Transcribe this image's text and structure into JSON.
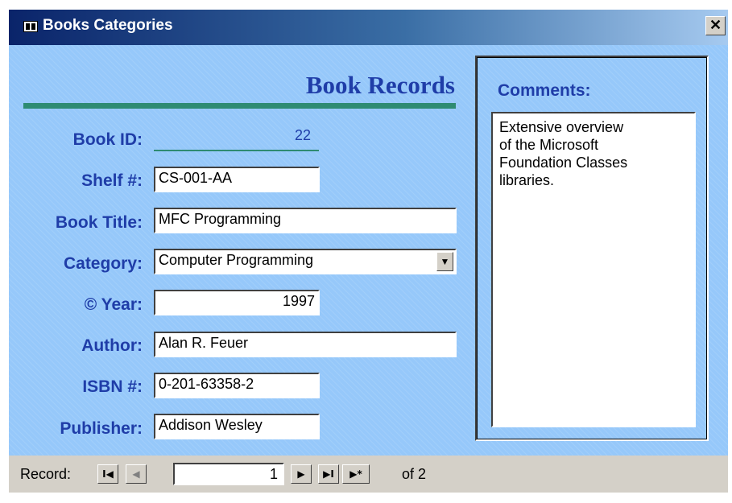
{
  "window": {
    "title": "Books Categories",
    "close_glyph": "✕"
  },
  "form": {
    "heading": "Book Records",
    "fields": {
      "book_id": {
        "label": "Book ID:",
        "value": "22"
      },
      "shelf": {
        "label": "Shelf #:",
        "value": "CS-001-AA"
      },
      "title": {
        "label": "Book Title:",
        "value": "MFC Programming"
      },
      "category": {
        "label": "Category:",
        "value": "Computer Programming"
      },
      "year": {
        "label": "© Year:",
        "value": "1997"
      },
      "author": {
        "label": "Author:",
        "value": "Alan R. Feuer"
      },
      "isbn": {
        "label": "ISBN #:",
        "value": "0-201-63358-2"
      },
      "publisher": {
        "label": "Publisher:",
        "value": "Addison Wesley"
      }
    },
    "comments": {
      "label": "Comments:",
      "text": "Extensive overview\nof the Microsoft\nFoundation Classes\nlibraries."
    }
  },
  "navigation": {
    "label": "Record:",
    "current": "1",
    "of_label": "of",
    "total": "2",
    "first_glyph": "I◀",
    "prev_glyph": "◀",
    "next_glyph": "▶",
    "last_glyph": "▶I",
    "new_glyph": "▶*"
  },
  "colors": {
    "form_background": "#96c8fa",
    "label_blue": "#1f3da8",
    "accent_green": "#2e8b72",
    "titlebar_dark": "#0a246a"
  }
}
